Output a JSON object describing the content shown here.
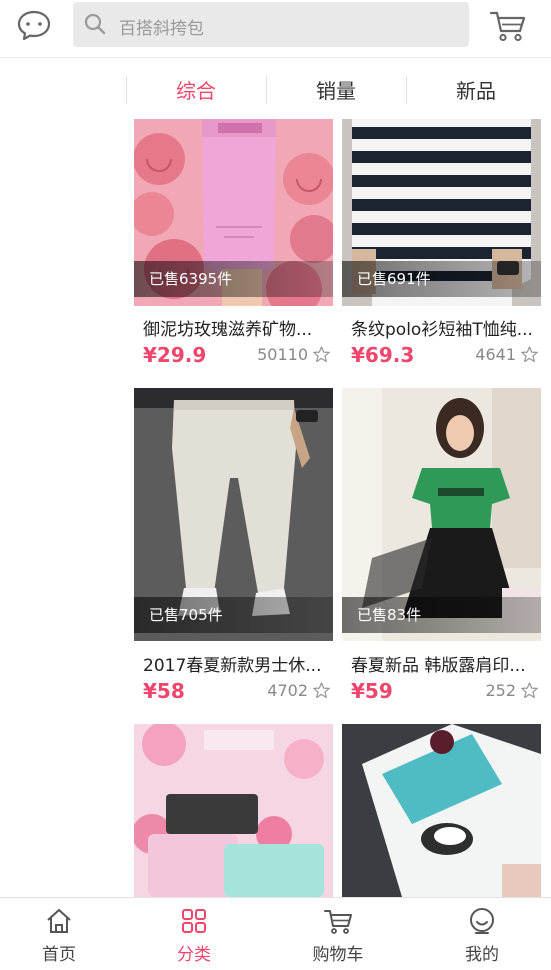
{
  "header": {
    "search_placeholder": "百搭斜挎包",
    "chat_icon": "chat-bubble-icon",
    "cart_icon": "cart-icon"
  },
  "tabs": [
    {
      "label": "综合",
      "active": true
    },
    {
      "label": "销量",
      "active": false
    },
    {
      "label": "新品",
      "active": false
    }
  ],
  "products": [
    {
      "name": "御泥坊玫瑰滋养矿物...",
      "price": "¥29.9",
      "sold": "已售6395件",
      "favorites": "50110"
    },
    {
      "name": "条纹polo衫短袖T恤纯...",
      "price": "¥69.3",
      "sold": "已售691件",
      "favorites": "4641"
    },
    {
      "name": "2017春夏新款男士休...",
      "price": "¥58",
      "sold": "已售705件",
      "favorites": "4702"
    },
    {
      "name": "春夏新品 韩版露肩印...",
      "price": "¥59",
      "sold": "已售83件",
      "favorites": "252"
    }
  ],
  "bottom_nav": [
    {
      "label": "首页",
      "icon": "home-icon",
      "active": false
    },
    {
      "label": "分类",
      "icon": "category-icon",
      "active": true
    },
    {
      "label": "购物车",
      "icon": "cart-icon",
      "active": false
    },
    {
      "label": "我的",
      "icon": "profile-icon",
      "active": false
    }
  ],
  "colors": {
    "accent": "#f0466c"
  }
}
